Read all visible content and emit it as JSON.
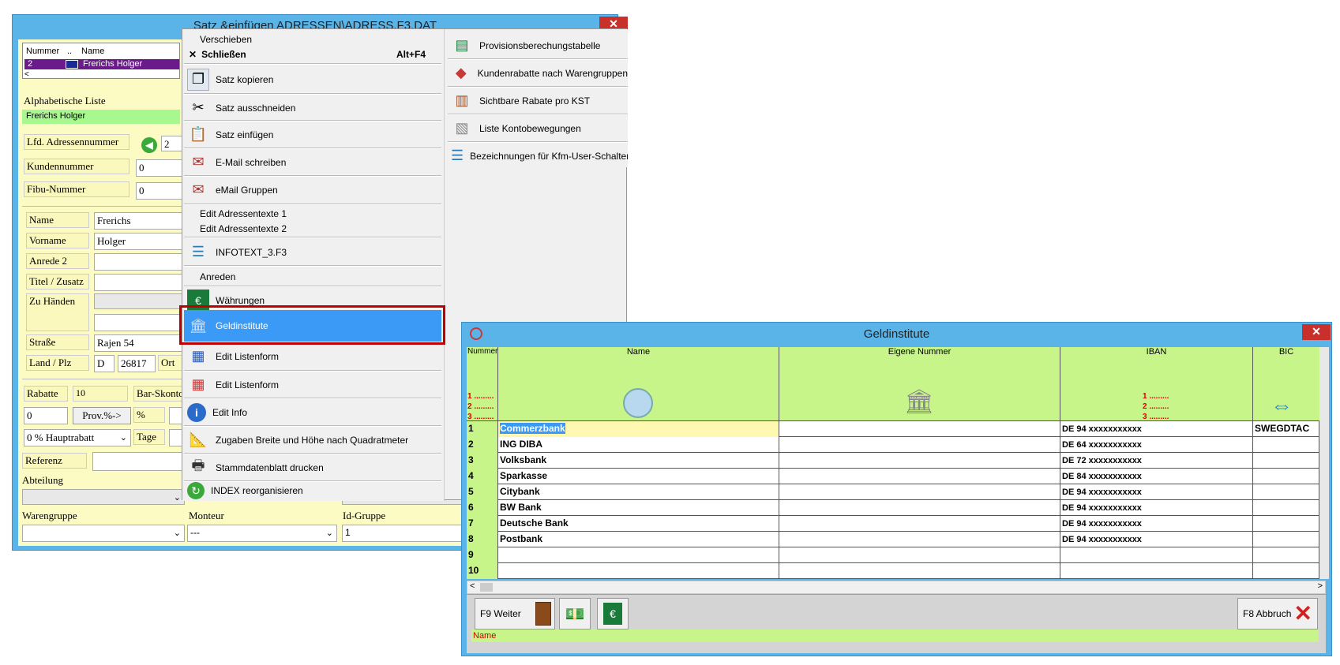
{
  "window1": {
    "title": "Satz &einfügen    ADRESSEN\\ADRESS.F3.DAT",
    "close": "✕",
    "list_headers": {
      "nummer": "Nummer",
      "dots": "..",
      "name": "Name"
    },
    "list_row": {
      "nummer": "2",
      "name": "Frerichs Holger"
    },
    "alpha_label": "Alphabetische Liste",
    "alpha_value": "Frerichs Holger",
    "lfd_label": "Lfd. Adressennummer",
    "lfd_value": "2",
    "kunden_label": "Kundennummer",
    "kunden_value": "0",
    "fibu_label": "Fibu-Nummer",
    "fibu_value": "0",
    "name_label": "Name",
    "name_value": "Frerichs",
    "vorname_label": "Vorname",
    "vorname_value": "Holger",
    "anrede_label": "Anrede 2",
    "titel_label": "Titel / Zusatz",
    "zuhanden_label": "Zu Händen",
    "strasse_label": "Straße",
    "strasse_value": "Rajen 54",
    "land_label": "Land / Plz",
    "land_value": "D",
    "plz_value": "26817",
    "ort_label": "Ort",
    "rabatte_label": "Rabatte",
    "rabatte_value": "10",
    "barskonto_label": "Bar-Skonto",
    "rabatt0_value": "0",
    "prov_label": "Prov.%->",
    "percent": "%",
    "hauptrabatt": "0 % Hauptrabatt",
    "tage_label": "Tage",
    "referenz_label": "Referenz",
    "abteilung_label": "Abteilung",
    "warengruppe_label": "Warengruppe",
    "monteur_label": "Monteur",
    "monteur_value": "---",
    "idgruppe_label": "Id-Gruppe",
    "idgruppe_value": "1"
  },
  "context_menu": {
    "verschieben": "Verschieben",
    "schliessen": "Schließen",
    "schliessen_shortcut": "Alt+F4",
    "items": [
      {
        "label": "Satz kopieren",
        "icon": "copy-icon"
      },
      {
        "label": "Satz ausschneiden",
        "icon": "scissors-icon"
      },
      {
        "label": "Satz einfügen",
        "icon": "paste-icon"
      },
      {
        "label": "E-Mail schreiben",
        "icon": "email-icon"
      },
      {
        "label": "eMail Gruppen",
        "icon": "email-group-icon"
      }
    ],
    "edit_adressentexte_1": "Edit Adressentexte 1",
    "edit_adressentexte_2": "Edit Adressentexte 2",
    "infotext": "INFOTEXT_3.F3",
    "anreden": "Anreden",
    "waehrungen": "Währungen",
    "geldinstitute": "Geldinstitute",
    "edit_listenform_1": "Edit Listenform",
    "edit_listenform_2": "Edit Listenform",
    "edit_info": "Edit Info",
    "zugaben": "Zugaben Breite und Höhe nach Quadratmeter",
    "stammdatenblatt": "Stammdatenblatt drucken",
    "index": "INDEX reorganisieren",
    "right": [
      "Provisionsberechungstabelle",
      "Kundenrabatte nach Warengruppen",
      "Sichtbare Rabate pro KST",
      "Liste Kontobewegungen",
      "Bezeichnungen für Kfm-User-Schalter"
    ]
  },
  "window2": {
    "title": "Geldinstitute",
    "close": "✕",
    "headers": {
      "nummer": "Nummer",
      "name": "Name",
      "eigene": "Eigene Nummer",
      "iban": "IBAN",
      "bic": "BIC"
    },
    "redlines": [
      "1 .........",
      "2 .........",
      "3 ........."
    ],
    "rows": [
      {
        "n": "1",
        "name": "Commerzbank",
        "iban": "DE 94 xxxxxxxxxxx",
        "bic": "SWEGDTAC"
      },
      {
        "n": "2",
        "name": "ING DIBA",
        "iban": "DE 64 xxxxxxxxxxx",
        "bic": ""
      },
      {
        "n": "3",
        "name": "Volksbank",
        "iban": "DE 72 xxxxxxxxxxx",
        "bic": ""
      },
      {
        "n": "4",
        "name": "Sparkasse",
        "iban": "DE 84 xxxxxxxxxxx",
        "bic": ""
      },
      {
        "n": "5",
        "name": "Citybank",
        "iban": "DE 94 xxxxxxxxxxx",
        "bic": ""
      },
      {
        "n": "6",
        "name": "BW Bank",
        "iban": "DE 94 xxxxxxxxxxx",
        "bic": ""
      },
      {
        "n": "7",
        "name": "Deutsche Bank",
        "iban": "DE 94 xxxxxxxxxxx",
        "bic": ""
      },
      {
        "n": "8",
        "name": "Postbank",
        "iban": "DE 94 xxxxxxxxxxx",
        "bic": ""
      },
      {
        "n": "9",
        "name": "",
        "iban": "",
        "bic": ""
      },
      {
        "n": "10",
        "name": "",
        "iban": "",
        "bic": ""
      }
    ],
    "f9": "F9 Weiter",
    "f8": "F8 Abbruch",
    "status": "Name"
  }
}
